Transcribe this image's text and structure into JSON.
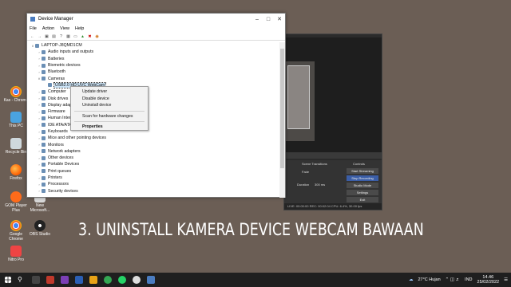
{
  "desktop": {
    "icons": [
      {
        "label": "Kas - Chrome",
        "icon": "chrome-icon"
      },
      {
        "label": "This PC",
        "icon": "this-pc-icon"
      },
      {
        "label": "Recycle Bin",
        "icon": "recycle-bin-icon"
      },
      {
        "label": "Firefox",
        "icon": "firefox-icon"
      },
      {
        "label": "GOM Player Plus",
        "icon": "gom-player-icon"
      },
      {
        "label": "New Microsoft...",
        "icon": "new-document-icon"
      },
      {
        "label": "Google Chrome",
        "icon": "chrome-icon"
      },
      {
        "label": "OBS Studio",
        "icon": "obs-icon"
      },
      {
        "label": "Nitro Pro",
        "icon": "nitro-icon"
      }
    ]
  },
  "device_manager": {
    "title": "Device Manager",
    "menu": [
      "File",
      "Action",
      "View",
      "Help"
    ],
    "tree": [
      {
        "label": "LAPTOP-J8QMD1CM",
        "level": 0,
        "expanded": true
      },
      {
        "label": "Audio inputs and outputs",
        "level": 1
      },
      {
        "label": "Batteries",
        "level": 1
      },
      {
        "label": "Biometric devices",
        "level": 1
      },
      {
        "label": "Bluetooth",
        "level": 1
      },
      {
        "label": "Cameras",
        "level": 1,
        "expanded": true
      },
      {
        "label": "USB2.0 HD UVC WebCam",
        "level": 2,
        "selected": true
      },
      {
        "label": "Computer",
        "level": 1
      },
      {
        "label": "Disk drives",
        "level": 1
      },
      {
        "label": "Display adapt",
        "level": 1
      },
      {
        "label": "Firmware",
        "level": 1
      },
      {
        "label": "Human Interf",
        "level": 1
      },
      {
        "label": "IDE ATA/ATAP",
        "level": 1
      },
      {
        "label": "Keyboards",
        "level": 1
      },
      {
        "label": "Mice and other pointing devices",
        "level": 1
      },
      {
        "label": "Monitors",
        "level": 1
      },
      {
        "label": "Network adapters",
        "level": 1
      },
      {
        "label": "Other devices",
        "level": 1
      },
      {
        "label": "Portable Devices",
        "level": 1
      },
      {
        "label": "Print queues",
        "level": 1
      },
      {
        "label": "Printers",
        "level": 1
      },
      {
        "label": "Processors",
        "level": 1
      },
      {
        "label": "Security devices",
        "level": 1
      }
    ],
    "context_menu": {
      "items": [
        {
          "label": "Update driver"
        },
        {
          "label": "Disable device"
        },
        {
          "label": "Uninstall device"
        },
        {
          "label": "Scan for hardware changes",
          "separator_before": true
        },
        {
          "label": "Properties",
          "separator_before": true,
          "bold": true
        }
      ]
    }
  },
  "obs": {
    "scene_transitions": "Scene Transitions",
    "controls": "Controls",
    "fade": "Fade",
    "duration_label": "Duration",
    "duration_value": "300 ms",
    "buttons": [
      "Start Streaming",
      "Stop Recording",
      "Studio Mode",
      "Settings",
      "Exit"
    ],
    "status": "LIVE: 00:00:00   REC: 00:02:04   CPU: 6.4%, 30.00 fps"
  },
  "caption": "3. UNINSTALL KAMERA DEVICE WEBCAM BAWAAN",
  "taskbar": {
    "weather": "27°C  Hujan",
    "language": "IND",
    "time": "14.46",
    "date": "25/02/2022"
  }
}
